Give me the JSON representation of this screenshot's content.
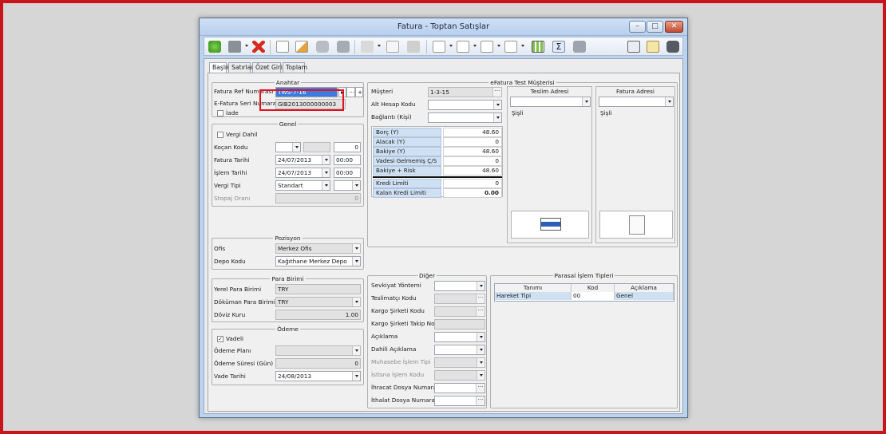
{
  "window": {
    "title": "Fatura - Toptan Satışlar",
    "controls": {
      "minimize": "–",
      "maximize": "□",
      "close": "✕"
    }
  },
  "toolbar": {
    "icons": [
      "add-icon",
      "save-icon",
      "delete-icon",
      "new-document-icon",
      "edit-icon",
      "print-preview-icon",
      "print-icon",
      "blank-icon",
      "add-line-icon",
      "archive-icon",
      "doc-a-icon",
      "doc-b-icon",
      "doc-c-icon",
      "doc-d-icon",
      "grid-view-icon",
      "sum-icon",
      "camera-icon",
      "display-icon",
      "note-icon",
      "binoculars-icon"
    ]
  },
  "tabs": [
    "Başlık",
    "Satırlar",
    "Özet Giriş",
    "Toplam"
  ],
  "anahtar": {
    "title": "Anahtar",
    "fatura_ref_label": "Fatura Ref Numarası",
    "fatura_ref_value": "TWS-7-16",
    "efatura_label": "E-Fatura Seri Numarası",
    "efatura_value": "GIB2013000000003",
    "iade_label": "İade"
  },
  "genel": {
    "title": "Genel",
    "vergi_dahil": "Vergi Dahil",
    "kocan_label": "Koçan Kodu",
    "kocan_num": "0",
    "fatura_tarihi_label": "Fatura Tarihi",
    "fatura_tarihi": "24/07/2013",
    "fatura_saat": "00:00",
    "islem_tarihi_label": "İşlem Tarihi",
    "islem_tarihi": "24/07/2013",
    "islem_saat": "00:00",
    "vergi_tipi_label": "Vergi Tipi",
    "vergi_tipi": "Standart",
    "stopaj_label": "Stopaj Oranı",
    "stopaj": "0"
  },
  "pozisyon": {
    "title": "Pozisyon",
    "ofis_label": "Ofis",
    "ofis": "Merkez Ofis",
    "depo_label": "Depo Kodu",
    "depo": "Kağıthane Merkez Depo"
  },
  "para_birimi": {
    "title": "Para Birimi",
    "yerel_label": "Yerel Para Birimi",
    "yerel": "TRY",
    "dokuman_label": "Döküman Para Birimi",
    "dokuman": "TRY",
    "doviz_label": "Döviz Kuru",
    "doviz": "1.00"
  },
  "odeme": {
    "title": "Ödeme",
    "vadeli": "Vadeli",
    "plan_label": "Ödeme Planı",
    "sure_label": "Ödeme Süresi (Gün)",
    "sure": "0",
    "vade_label": "Vade Tarihi",
    "vade": "24/08/2013"
  },
  "efatura": {
    "title": "eFatura Test Müşterisi",
    "musteri_label": "Müşteri",
    "musteri": "1-3-15",
    "alt_hesap_label": "Alt Hesap Kodu",
    "baglanti_label": "Bağlantı (Kişi)",
    "balances": [
      {
        "label": "Borç (Y)",
        "value": "48.60"
      },
      {
        "label": "Alacak (Y)",
        "value": "0"
      },
      {
        "label": "Bakiye (Y)",
        "value": "48.60"
      },
      {
        "label": "Vadesi Gelmemiş Ç/S Riski",
        "value": "0"
      },
      {
        "label": "Bakiye + Risk",
        "value": "48.60"
      },
      {
        "label": "Kredi Limiti",
        "value": "0"
      },
      {
        "label": "Kalan Kredi Limiti",
        "value": "0.00"
      }
    ],
    "teslim_title": "Teslim Adresi",
    "teslim_city": "Şişli",
    "fatura_adres_title": "Fatura Adresi",
    "fatura_city": "Şişli"
  },
  "diger": {
    "title": "Diğer",
    "sevkiyat": "Sevkiyat Yöntemi",
    "teslimatci": "Teslimatçı Kodu",
    "kargo": "Kargo Şirketi Kodu",
    "kargo_takip": "Kargo Şirketi Takip No",
    "aciklama": "Açıklama",
    "dahili": "Dahili Açıklama",
    "muhasebe": "Muhasebe İşlem Tipi",
    "istisna": "İstisna İşlem Kodu",
    "ihracat": "İhracat Dosya Numarası",
    "ithalat": "İthalat Dosya Numarası"
  },
  "parasal": {
    "title": "Parasal İşlem Tipleri",
    "columns": [
      "Tanımı",
      "Kod",
      "Açıklama"
    ],
    "row": {
      "tanim": "Hareket Tipi",
      "kod": "00",
      "aciklama": "Genel"
    }
  }
}
